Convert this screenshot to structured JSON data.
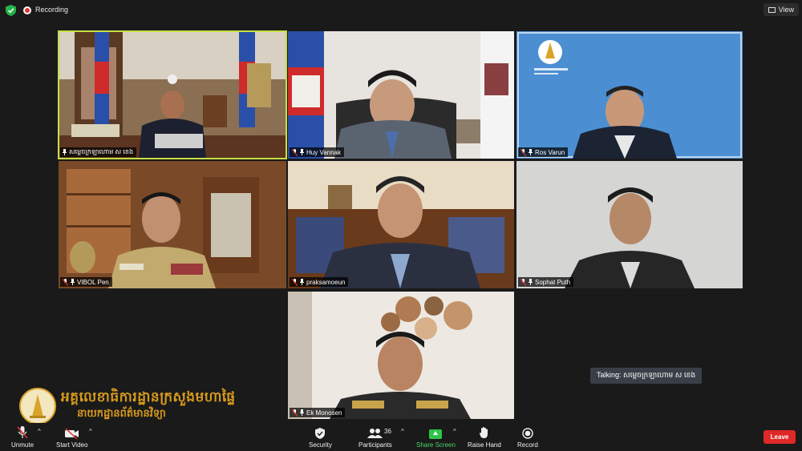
{
  "topbar": {
    "recording_label": "Recording",
    "view_label": "View"
  },
  "participants": [
    {
      "name": "សម្តេចក្រឡាហោម ស ខេង",
      "active": true
    },
    {
      "name": "Huy Vannak"
    },
    {
      "name": "Ros Varun"
    },
    {
      "name": "VIBOL Pen"
    },
    {
      "name": "praksamoeun"
    },
    {
      "name": "Sophat Puth"
    },
    {
      "name": "Ek Monosen"
    }
  ],
  "talking": {
    "label": "Talking: សម្តេចក្រឡាហោម ស ខេង"
  },
  "watermark": {
    "line1": "អគ្គលេខាធិការដ្ឋានក្រសួងមហាផ្ទៃ",
    "line2": "នាយកដ្ឋានព័ត៌មានវិទ្យា"
  },
  "toolbar": {
    "unmute": "Unmute",
    "start_video": "Start Video",
    "security": "Security",
    "participants": "Participants",
    "participants_count": "36",
    "share_screen": "Share Screen",
    "raise_hand": "Raise Hand",
    "record": "Record",
    "leave": "Leave"
  },
  "colors": {
    "active_border": "#c7e046",
    "share_green": "#2ec54a",
    "leave_red": "#e02828",
    "watermark_gold": "#d89a1c"
  }
}
